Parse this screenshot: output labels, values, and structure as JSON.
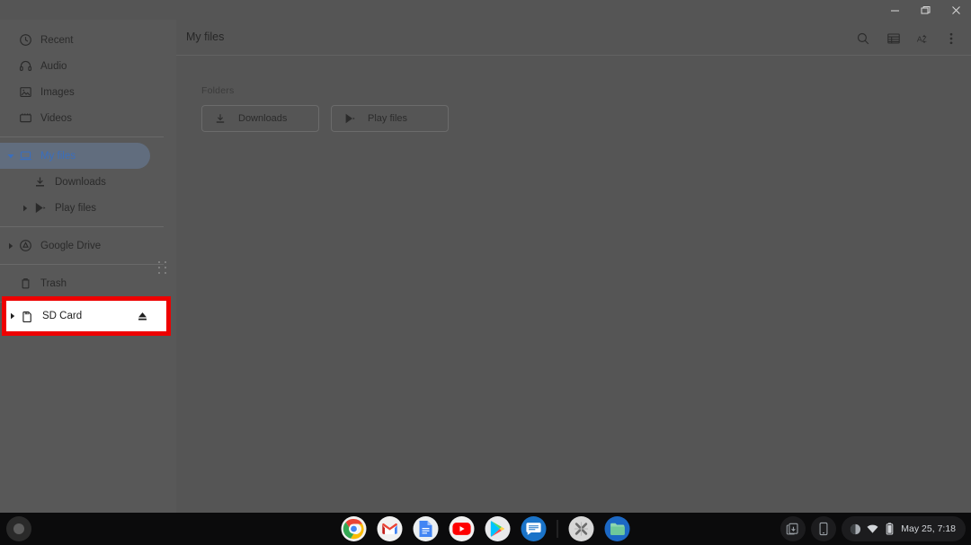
{
  "window": {
    "controls": {
      "minimize": "minimize",
      "maximize": "restore",
      "close": "close"
    }
  },
  "sidebar": {
    "items": [
      {
        "label": "Recent",
        "icon": "clock-icon",
        "indent": false,
        "twisty": "none",
        "selected": false
      },
      {
        "label": "Audio",
        "icon": "headphones-icon",
        "indent": false,
        "twisty": "none",
        "selected": false
      },
      {
        "label": "Images",
        "icon": "image-icon",
        "indent": false,
        "twisty": "none",
        "selected": false
      },
      {
        "label": "Videos",
        "icon": "video-icon",
        "indent": false,
        "twisty": "none",
        "selected": false
      },
      {
        "label": "My files",
        "icon": "laptop-icon",
        "indent": false,
        "twisty": "expanded",
        "selected": true
      },
      {
        "label": "Downloads",
        "icon": "download-icon",
        "indent": true,
        "twisty": "none",
        "selected": false
      },
      {
        "label": "Play files",
        "icon": "play-store-icon",
        "indent": true,
        "twisty": "collapsed",
        "selected": false
      },
      {
        "label": "Google Drive",
        "icon": "google-drive-icon",
        "indent": false,
        "twisty": "collapsed",
        "selected": false
      },
      {
        "label": "Trash",
        "icon": "trash-icon",
        "indent": false,
        "twisty": "none",
        "selected": false
      }
    ],
    "sd_card": {
      "label": "SD Card",
      "icon": "sd-card-icon",
      "twisty": "collapsed",
      "eject_icon": "eject-icon"
    },
    "splitter": "drag-handle-icon"
  },
  "main": {
    "title": "My files",
    "toolbar": {
      "search": "search-icon",
      "view": "list-view-icon",
      "sort": "sort-az-icon",
      "more": "more-vertical-icon"
    },
    "folders_label": "Folders",
    "folders": [
      {
        "label": "Downloads",
        "icon": "download-icon"
      },
      {
        "label": "Play files",
        "icon": "play-store-icon"
      }
    ]
  },
  "annotation": {
    "color": "#ee0000",
    "target": "SD Card"
  },
  "shelf": {
    "launcher": "launcher-icon",
    "apps": [
      {
        "name": "chrome-icon",
        "running": true
      },
      {
        "name": "gmail-icon",
        "running": true
      },
      {
        "name": "google-docs-icon",
        "running": true
      },
      {
        "name": "youtube-icon",
        "running": false
      },
      {
        "name": "play-store-icon",
        "running": false
      },
      {
        "name": "messages-icon",
        "running": false
      },
      {
        "name": "x-app-icon",
        "running": true
      },
      {
        "name": "files-icon",
        "running": true
      }
    ],
    "status": {
      "screen_capture": "screen-capture-icon",
      "phone_hub": "phone-hub-icon",
      "tray_icons": [
        "contrast-icon",
        "wifi-icon",
        "battery-icon"
      ],
      "datetime": "May 25, 7:18"
    }
  }
}
